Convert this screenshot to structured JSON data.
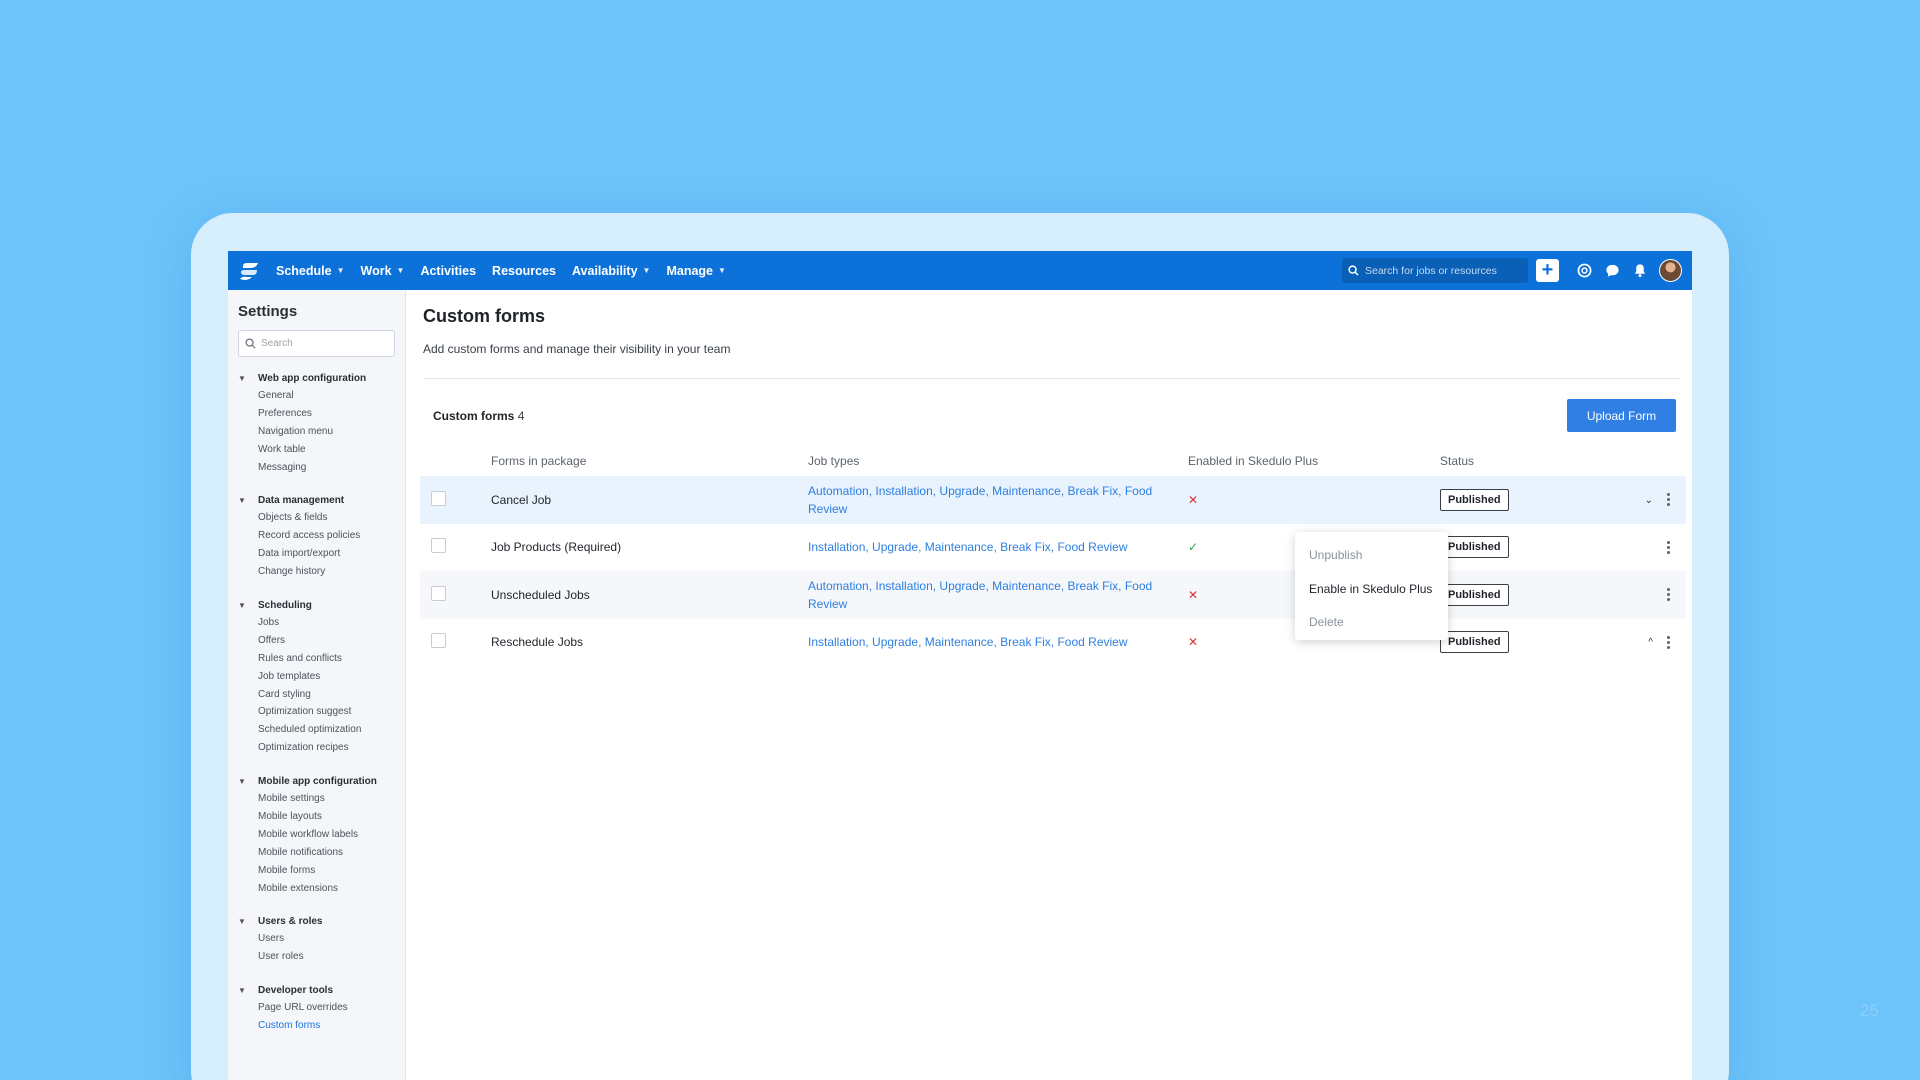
{
  "slide": {
    "page_number": "25"
  },
  "topnav": {
    "items": [
      {
        "label": "Schedule",
        "has_caret": true
      },
      {
        "label": "Work",
        "has_caret": true
      },
      {
        "label": "Activities",
        "has_caret": false
      },
      {
        "label": "Resources",
        "has_caret": false
      },
      {
        "label": "Availability",
        "has_caret": true
      },
      {
        "label": "Manage",
        "has_caret": true
      }
    ],
    "search_placeholder": "Search for jobs or resources",
    "plus_label": "+",
    "brand_color": "#0c72d9"
  },
  "sidebar": {
    "title": "Settings",
    "search_placeholder": "Search",
    "groups": [
      {
        "label": "Web app configuration",
        "items": [
          "General",
          "Preferences",
          "Navigation menu",
          "Work table",
          "Messaging"
        ]
      },
      {
        "label": "Data management",
        "items": [
          "Objects & fields",
          "Record access policies",
          "Data import/export",
          "Change history"
        ]
      },
      {
        "label": "Scheduling",
        "items": [
          "Jobs",
          "Offers",
          "Rules and conflicts",
          "Job templates",
          "Card styling",
          "Optimization suggest",
          "Scheduled optimization",
          "Optimization recipes"
        ]
      },
      {
        "label": "Mobile app configuration",
        "items": [
          "Mobile settings",
          "Mobile layouts",
          "Mobile workflow labels",
          "Mobile notifications",
          "Mobile forms",
          "Mobile extensions"
        ]
      },
      {
        "label": "Users & roles",
        "items": [
          "Users",
          "User roles"
        ]
      },
      {
        "label": "Developer tools",
        "items": [
          "Page URL overrides",
          "Custom forms"
        ]
      }
    ],
    "active_item": "Custom forms"
  },
  "main": {
    "title": "Custom forms",
    "description": "Add custom forms and manage their visibility in your team",
    "section_title": "Custom forms",
    "section_count": "4",
    "upload_label": "Upload Form",
    "columns": [
      "Forms in package",
      "Job types",
      "Enabled in Skedulo Plus",
      "Status"
    ],
    "rows": [
      {
        "name": "Cancel Job",
        "job_types": "Automation, Installation, Upgrade, Maintenance, Break Fix, Food Review",
        "enabled": false,
        "enabled_symbol": "✕",
        "status": "Published",
        "chevron": "⌄"
      },
      {
        "name": "Job Products (Required)",
        "job_types": "Installation, Upgrade, Maintenance, Break Fix, Food Review",
        "enabled": true,
        "enabled_symbol": "✓",
        "status": "Published",
        "chevron": ""
      },
      {
        "name": "Unscheduled Jobs",
        "job_types": "Automation, Installation, Upgrade, Maintenance, Break Fix, Food Review",
        "enabled": false,
        "enabled_symbol": "✕",
        "status": "Published",
        "chevron": ""
      },
      {
        "name": "Reschedule Jobs",
        "job_types": "Installation, Upgrade, Maintenance, Break Fix, Food Review",
        "enabled": false,
        "enabled_symbol": "✕",
        "status": "Published",
        "chevron": "^"
      }
    ]
  },
  "menu": {
    "items": [
      "Unpublish",
      "Enable in Skedulo Plus",
      "Delete"
    ]
  }
}
